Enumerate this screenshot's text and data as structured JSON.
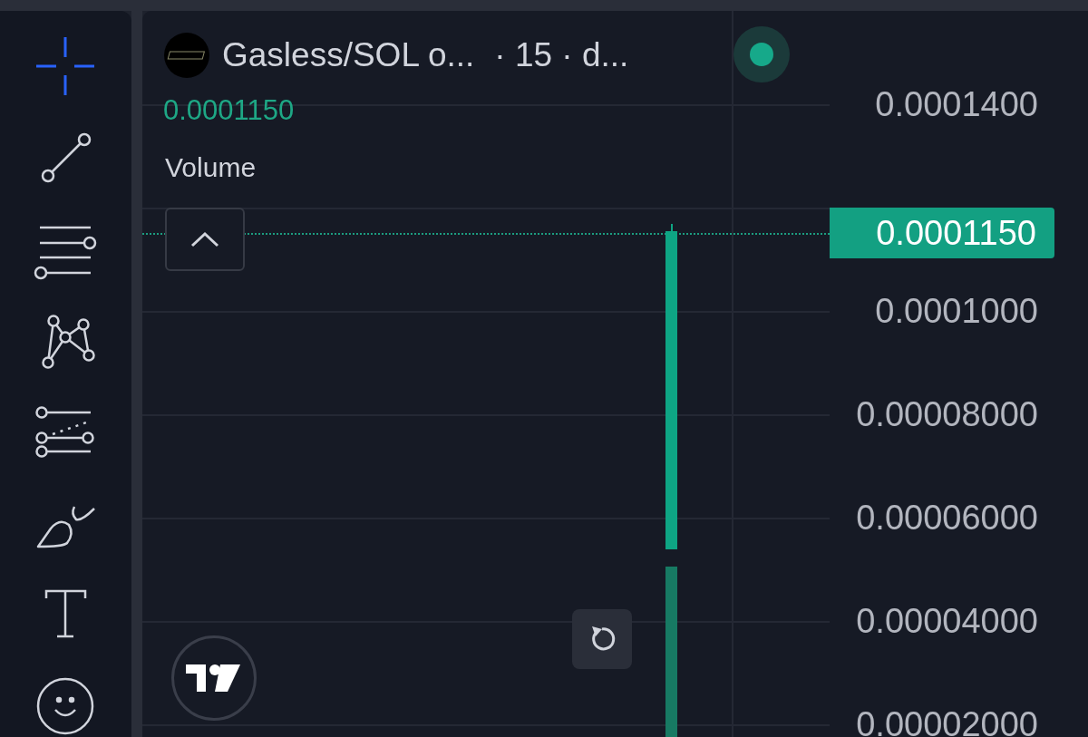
{
  "toolbar": {
    "tools": [
      {
        "kind": "crosshair",
        "selected": true
      },
      {
        "kind": "trendline",
        "selected": false
      },
      {
        "kind": "horizontal-lines",
        "selected": false
      },
      {
        "kind": "pattern",
        "selected": false
      },
      {
        "kind": "fibonacci",
        "selected": false
      },
      {
        "kind": "brush",
        "selected": false
      },
      {
        "kind": "text",
        "selected": false
      },
      {
        "kind": "emoji",
        "selected": false
      }
    ]
  },
  "legend": {
    "symbol": "Gasless/SOL o...",
    "meta": "· 15 · d...",
    "price": "0.0001150",
    "indicator": "Volume",
    "live": true
  },
  "price_axis": {
    "labels": [
      "0.0001400",
      "0.0001000",
      "0.00008000",
      "0.00006000",
      "0.00004000",
      "0.00002000"
    ],
    "current_price": "0.0001150"
  }
}
